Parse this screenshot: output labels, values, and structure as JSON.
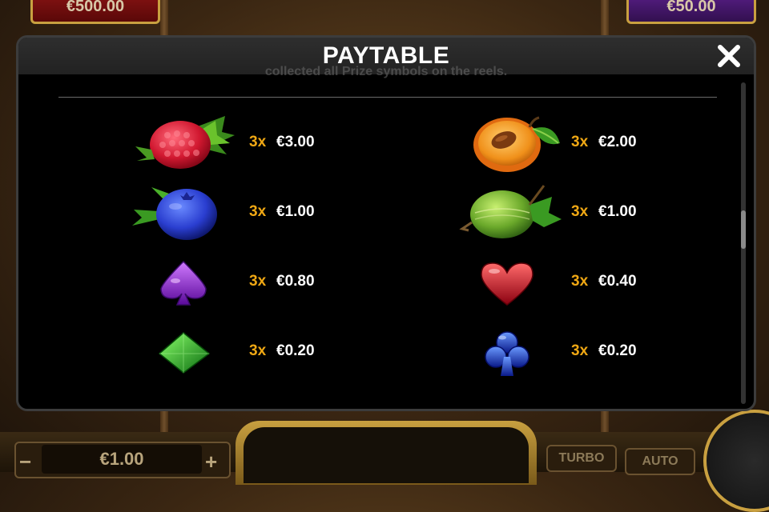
{
  "background": {
    "left_box": "€500.00",
    "right_box": "€50.00",
    "bet_value": "€1.00",
    "bet_minus": "−",
    "bet_plus": "+",
    "turbo_label": "TURBO",
    "auto_label": "AUTO"
  },
  "modal": {
    "title": "PAYTABLE",
    "close_icon": "×",
    "partial_text": "collected all Prize symbols on the reels.",
    "rows": [
      {
        "symbol": "raspberry",
        "multiplier": "3x",
        "payout": "€3.00"
      },
      {
        "symbol": "apricot",
        "multiplier": "3x",
        "payout": "€2.00"
      },
      {
        "symbol": "blueberry",
        "multiplier": "3x",
        "payout": "€1.00"
      },
      {
        "symbol": "gooseberry",
        "multiplier": "3x",
        "payout": "€1.00"
      },
      {
        "symbol": "spade",
        "multiplier": "3x",
        "payout": "€0.80"
      },
      {
        "symbol": "heart",
        "multiplier": "3x",
        "payout": "€0.40"
      },
      {
        "symbol": "diamond",
        "multiplier": "3x",
        "payout": "€0.20"
      },
      {
        "symbol": "club",
        "multiplier": "3x",
        "payout": "€0.20"
      }
    ]
  },
  "colors": {
    "multiplier": "#f0a814",
    "payout": "#ffffff",
    "header": "#2a2a2a"
  }
}
